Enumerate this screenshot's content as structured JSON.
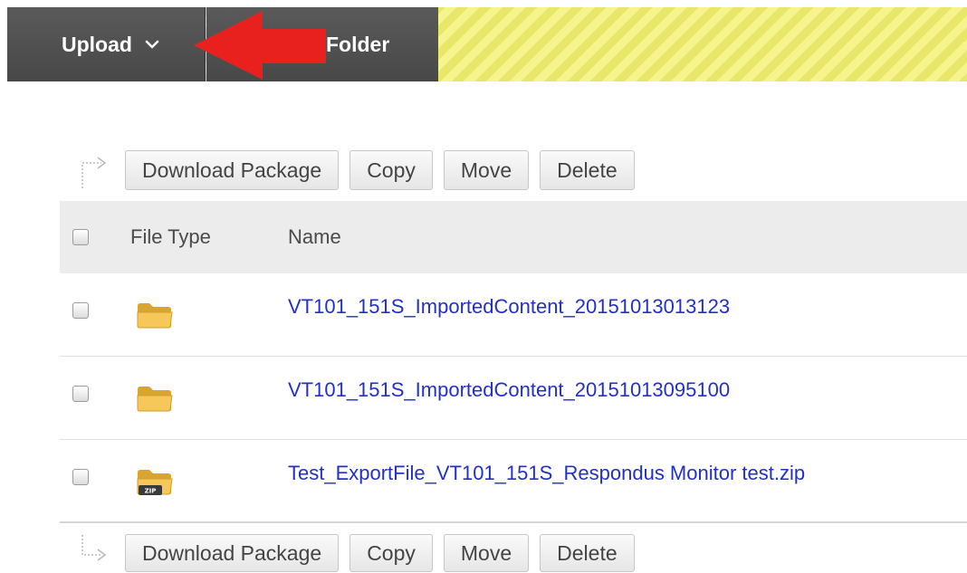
{
  "toolbar": {
    "upload_label": "Upload",
    "folder_label": "Folder",
    "annotation_color": "#e8211f"
  },
  "bulk_actions": {
    "download_package": "Download Package",
    "copy": "Copy",
    "move": "Move",
    "delete": "Delete"
  },
  "table": {
    "columns": {
      "file_type": "File Type",
      "name": "Name"
    },
    "rows": [
      {
        "type": "folder",
        "name": "VT101_151S_ImportedContent_20151013013123"
      },
      {
        "type": "folder",
        "name": "VT101_151S_ImportedContent_20151013095100"
      },
      {
        "type": "zip-folder",
        "name": "Test_ExportFile_VT101_151S_Respondus Monitor test.zip",
        "icon_label": "ZIP"
      }
    ]
  },
  "colors": {
    "toolbar_bg": "#505050",
    "stripe_yellow": "#f3f27a",
    "link_blue": "#2230c8",
    "header_bg": "#ececec"
  }
}
